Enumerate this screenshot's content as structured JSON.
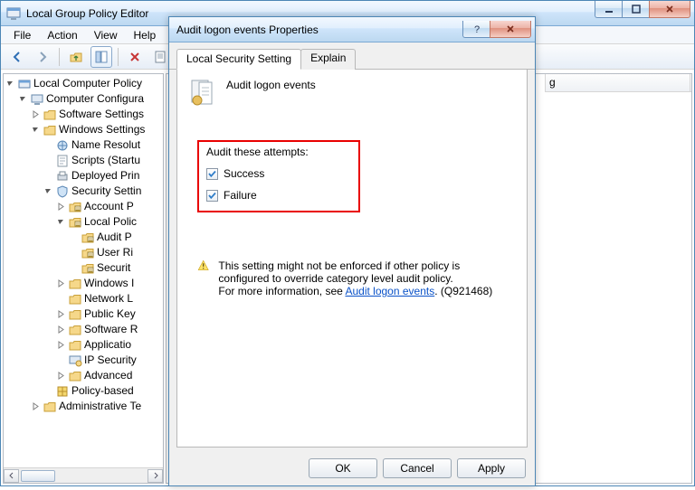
{
  "main_window": {
    "title": "Local Group Policy Editor",
    "menu": [
      "File",
      "Action",
      "View",
      "Help"
    ],
    "toolbar_icons": [
      "back",
      "forward",
      "up-folder",
      "tree-toggle",
      "delete",
      "refresh",
      "properties"
    ]
  },
  "tree": {
    "root": "Local Computer Policy",
    "nodes": [
      {
        "depth": 0,
        "exp": "open",
        "icon": "computer",
        "label": "Computer Configura"
      },
      {
        "depth": 1,
        "exp": "closed",
        "icon": "folder",
        "label": "Software Settings"
      },
      {
        "depth": 1,
        "exp": "open",
        "icon": "folder",
        "label": "Windows Settings"
      },
      {
        "depth": 2,
        "exp": "none",
        "icon": "name-res",
        "label": "Name Resolut"
      },
      {
        "depth": 2,
        "exp": "none",
        "icon": "script",
        "label": "Scripts (Startu"
      },
      {
        "depth": 2,
        "exp": "none",
        "icon": "printer",
        "label": "Deployed Prin"
      },
      {
        "depth": 2,
        "exp": "open",
        "icon": "security",
        "label": "Security Settin"
      },
      {
        "depth": 3,
        "exp": "closed",
        "icon": "folder-sec",
        "label": "Account P"
      },
      {
        "depth": 3,
        "exp": "open",
        "icon": "folder-sec",
        "label": "Local Polic"
      },
      {
        "depth": 4,
        "exp": "none",
        "icon": "folder-sec",
        "label": "Audit P"
      },
      {
        "depth": 4,
        "exp": "none",
        "icon": "folder-sec",
        "label": "User Ri"
      },
      {
        "depth": 4,
        "exp": "none",
        "icon": "folder-sec",
        "label": "Securit"
      },
      {
        "depth": 3,
        "exp": "closed",
        "icon": "folder",
        "label": "Windows I"
      },
      {
        "depth": 3,
        "exp": "none",
        "icon": "folder",
        "label": "Network L"
      },
      {
        "depth": 3,
        "exp": "closed",
        "icon": "folder",
        "label": "Public Key"
      },
      {
        "depth": 3,
        "exp": "closed",
        "icon": "folder",
        "label": "Software R"
      },
      {
        "depth": 3,
        "exp": "closed",
        "icon": "folder",
        "label": "Applicatio"
      },
      {
        "depth": 3,
        "exp": "none",
        "icon": "ipsec",
        "label": "IP Security"
      },
      {
        "depth": 3,
        "exp": "closed",
        "icon": "folder",
        "label": "Advanced "
      },
      {
        "depth": 2,
        "exp": "none",
        "icon": "policy",
        "label": "Policy-based "
      },
      {
        "depth": 1,
        "exp": "closed",
        "icon": "folder",
        "label": "Administrative Te"
      }
    ]
  },
  "right_pane": {
    "col_header_fragment": "g"
  },
  "dialog": {
    "title": "Audit logon events Properties",
    "tabs": [
      "Local Security Setting",
      "Explain"
    ],
    "active_tab": 0,
    "policy_name": "Audit logon events",
    "attempts_label": "Audit these attempts:",
    "checkboxes": [
      {
        "label": "Success",
        "checked": true
      },
      {
        "label": "Failure",
        "checked": true
      }
    ],
    "note_line1": "This setting might not be enforced if other policy is configured to override category level audit policy.",
    "note_line2_prefix": "For more information, see ",
    "note_link_text": "Audit logon events",
    "note_kb": ". (Q921468)",
    "buttons": [
      "OK",
      "Cancel",
      "Apply"
    ]
  }
}
